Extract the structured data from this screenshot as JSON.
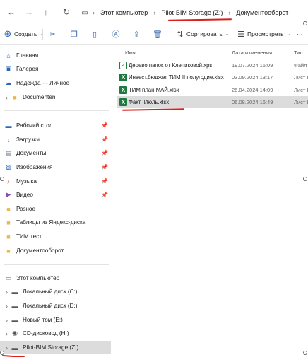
{
  "address": {
    "crumbs": [
      "Этот компьютер",
      "Pilot-BIM Storage (Z:)",
      "Документооборот"
    ],
    "separator": "›"
  },
  "toolbar": {
    "new_label": "Создать",
    "new_chevron": "⌄",
    "sort_label": "Сортировать",
    "sort_chevron": "⌄",
    "view_label": "Просмотреть",
    "view_chevron": "⌄",
    "more": "···"
  },
  "sidebar": {
    "quick": [
      {
        "label": "Главная",
        "icon": "home-icon"
      },
      {
        "label": "Галерея",
        "icon": "gallery-icon"
      },
      {
        "label": "Надежда — Личное",
        "icon": "cloud-icon"
      },
      {
        "label": "Documenten",
        "icon": "folder-icon"
      }
    ],
    "pinned": [
      {
        "label": "Рабочий стол",
        "icon": "desktop-icon"
      },
      {
        "label": "Загрузки",
        "icon": "download-icon"
      },
      {
        "label": "Документы",
        "icon": "documents-icon"
      },
      {
        "label": "Изображения",
        "icon": "pictures-icon"
      },
      {
        "label": "Музыка",
        "icon": "music-icon"
      },
      {
        "label": "Видео",
        "icon": "video-icon"
      }
    ],
    "folders": [
      {
        "label": "Разное",
        "icon": "folder-icon"
      },
      {
        "label": "Таблицы из Яндекс-диска",
        "icon": "folder-icon"
      },
      {
        "label": "ТИМ тест",
        "icon": "folder-icon"
      },
      {
        "label": "Документооборот",
        "icon": "folder-icon"
      }
    ],
    "pc": [
      {
        "label": "Этот компьютер",
        "icon": "computer-icon"
      },
      {
        "label": "Локальный диск (C:)",
        "icon": "drive-icon"
      },
      {
        "label": "Локальный диск (D:)",
        "icon": "drive-icon"
      },
      {
        "label": "Новый том (E:)",
        "icon": "drive-icon"
      },
      {
        "label": "CD-дисковод (H:)",
        "icon": "cd-icon"
      },
      {
        "label": "Pilot-BIM Storage (Z:)",
        "icon": "drive-icon"
      }
    ],
    "pin_glyph": "📌"
  },
  "content": {
    "headers": {
      "name": "Имя",
      "date": "Дата изменения",
      "type": "Тип"
    },
    "files": [
      {
        "name": "Дерево папок от Клепиковой.xps",
        "date": "19.07.2024 16:09",
        "type": "Файл",
        "icon": "xps-file-icon"
      },
      {
        "name": "Инвест.бюджет ТИМ II полугодие.xlsx",
        "date": "03.09.2024 13:17",
        "type": "Лист I",
        "icon": "excel-file-icon"
      },
      {
        "name": "ТИМ план МАЙ.xlsx",
        "date": "26.04.2024 14:09",
        "type": "Лист I",
        "icon": "excel-file-icon"
      },
      {
        "name": "Факт_Июль.xlsx",
        "date": "06.08.2024 16:49",
        "type": "Лист I",
        "icon": "excel-file-icon"
      }
    ]
  },
  "colors": {
    "annotation_red": "#d9201a",
    "selection": "#dcdcdc",
    "accent_blue": "#3a6fb0",
    "excel_green": "#1f7a3f",
    "folder_yellow": "#e9b949"
  }
}
